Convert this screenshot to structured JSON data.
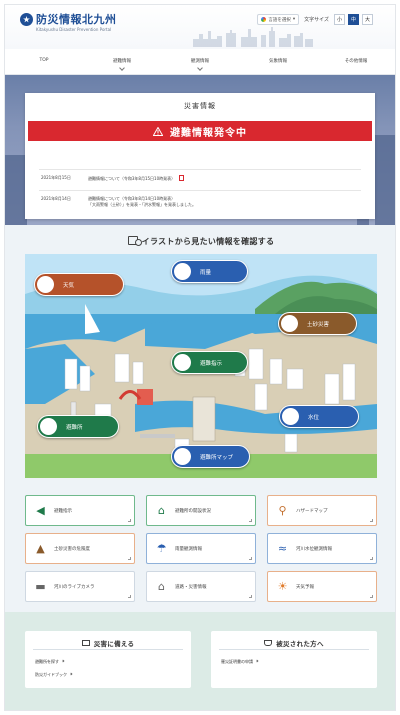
{
  "header": {
    "site_title": "防災情報北九州",
    "site_subtitle": "Kitakyushu Disaster Prevention Portal",
    "language_label": "言語を選択",
    "font_size_label": "文字サイズ",
    "font_size_buttons": [
      "小",
      "中",
      "大"
    ]
  },
  "nav": {
    "items": [
      {
        "label": "TOP",
        "dropdown": false
      },
      {
        "label": "避難情報",
        "dropdown": true
      },
      {
        "label": "観測情報",
        "dropdown": true
      },
      {
        "label": "気象情報",
        "dropdown": false
      },
      {
        "label": "その他情報",
        "dropdown": false
      }
    ]
  },
  "alert": {
    "section_title": "災害情報",
    "banner_text": "避難情報発令中",
    "banner_color": "#d9282f",
    "news": [
      {
        "date": "2021年8月15日",
        "text": "避難情報について（令和3年8月15日10時発表）"
      },
      {
        "date": "2021年8月14日",
        "text": "避難情報について（令和3年8月14日10時発表）",
        "text2": "「大雨警報（土砂）」を発表・「洪水警報」を発表しました。"
      }
    ]
  },
  "illustration": {
    "heading": "イラストから見たい情報を確認する",
    "hotspots": [
      {
        "label": "天気",
        "color": "#b5522a",
        "icon": "sun-cloud-icon"
      },
      {
        "label": "雨量",
        "color": "#2a5fb0",
        "icon": "rain-cloud-icon"
      },
      {
        "label": "土砂災害",
        "color": "#8a5a2b",
        "icon": "landslide-icon"
      },
      {
        "label": "避難指示",
        "color": "#1f7a4a",
        "icon": "megaphone-icon"
      },
      {
        "label": "避難所",
        "color": "#1f7a4a",
        "icon": "shelter-icon"
      },
      {
        "label": "水位",
        "color": "#2a5fb0",
        "icon": "water-wave-icon"
      },
      {
        "label": "避難所マップ",
        "color": "#2a5fb0",
        "icon": "map-icon"
      }
    ]
  },
  "tiles": [
    {
      "label": "避難指示",
      "icon": "megaphone-icon",
      "style": "green"
    },
    {
      "label": "避難所の開設状況",
      "icon": "shelter-icon",
      "style": "green"
    },
    {
      "label": "ハザードマップ",
      "icon": "map-pin-icon",
      "style": "orange"
    },
    {
      "label": "土砂災害の危険度",
      "icon": "landslide-icon",
      "style": "orange"
    },
    {
      "label": "雨量観測情報",
      "icon": "rain-cloud-icon",
      "style": "blue"
    },
    {
      "label": "河川水位観測情報",
      "icon": "water-wave-icon",
      "style": "blue"
    },
    {
      "label": "河川のライブカメラ",
      "icon": "camera-icon",
      "style": "gray"
    },
    {
      "label": "道路・災害情報",
      "icon": "house-road-icon",
      "style": "gray"
    },
    {
      "label": "天気予報",
      "icon": "sun-cloud-icon",
      "style": "orange"
    }
  ],
  "footer_panels": {
    "prepare": {
      "title": "災害に備える",
      "links": [
        "避難所を探す",
        "防災ガイドブック"
      ]
    },
    "affected": {
      "title": "被災された方へ",
      "links": [
        "罹災証明書の申請"
      ]
    }
  }
}
